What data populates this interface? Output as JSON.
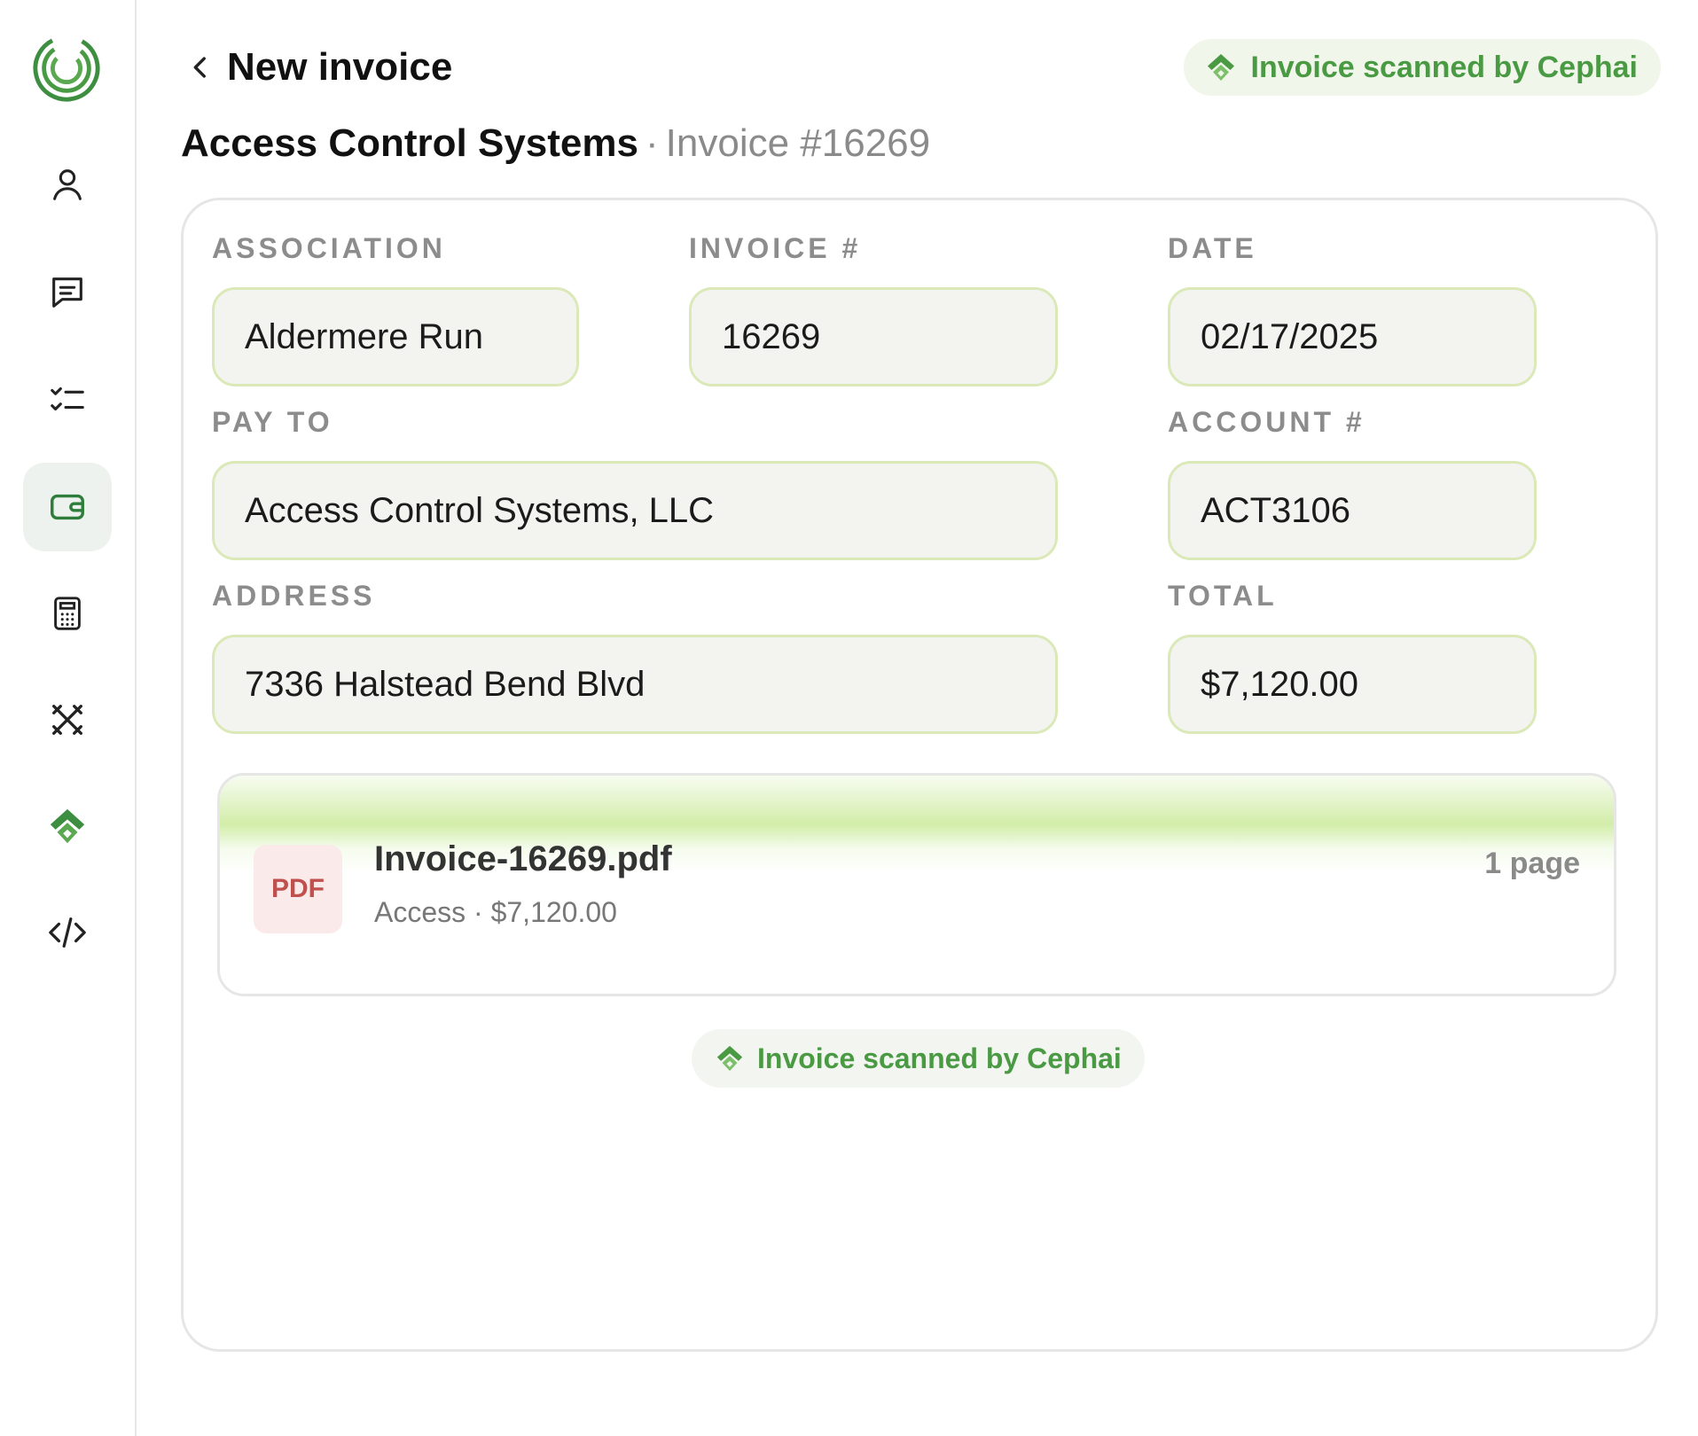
{
  "header": {
    "title": "New invoice",
    "badge_label": "Invoice scanned by Cephai"
  },
  "subtitle": {
    "company": "Access Control Systems",
    "separator": "·",
    "invoice_label": "Invoice #16269"
  },
  "sidebar": {
    "items": [
      {
        "icon": "user-icon"
      },
      {
        "icon": "chat-icon"
      },
      {
        "icon": "checklist-icon"
      },
      {
        "icon": "wallet-icon",
        "active": true
      },
      {
        "icon": "calculator-icon"
      },
      {
        "icon": "tools-icon"
      },
      {
        "icon": "cephai-icon"
      },
      {
        "icon": "code-icon"
      }
    ]
  },
  "form": {
    "association": {
      "label": "ASSOCIATION",
      "value": "Aldermere Run"
    },
    "invoice_no": {
      "label": "INVOICE #",
      "value": "16269"
    },
    "date": {
      "label": "DATE",
      "value": "02/17/2025"
    },
    "pay_to": {
      "label": "PAY TO",
      "value": "Access Control Systems, LLC"
    },
    "account_no": {
      "label": "ACCOUNT #",
      "value": "ACT3106"
    },
    "address": {
      "label": "ADDRESS",
      "value": "7336 Halstead Bend Blvd"
    },
    "total": {
      "label": "TOTAL",
      "value": "$7,120.00"
    }
  },
  "attachment": {
    "type_label": "PDF",
    "file_name": "Invoice-16269.pdf",
    "meta": "Access · $7,120.00",
    "pages": "1 page"
  },
  "footer_badge": {
    "label": "Invoice scanned by Cephai"
  },
  "colors": {
    "accent_green": "#4a9a44",
    "field_border": "#dbe8b8",
    "field_bg": "#f3f4f0",
    "pdf_red": "#c0504d"
  }
}
